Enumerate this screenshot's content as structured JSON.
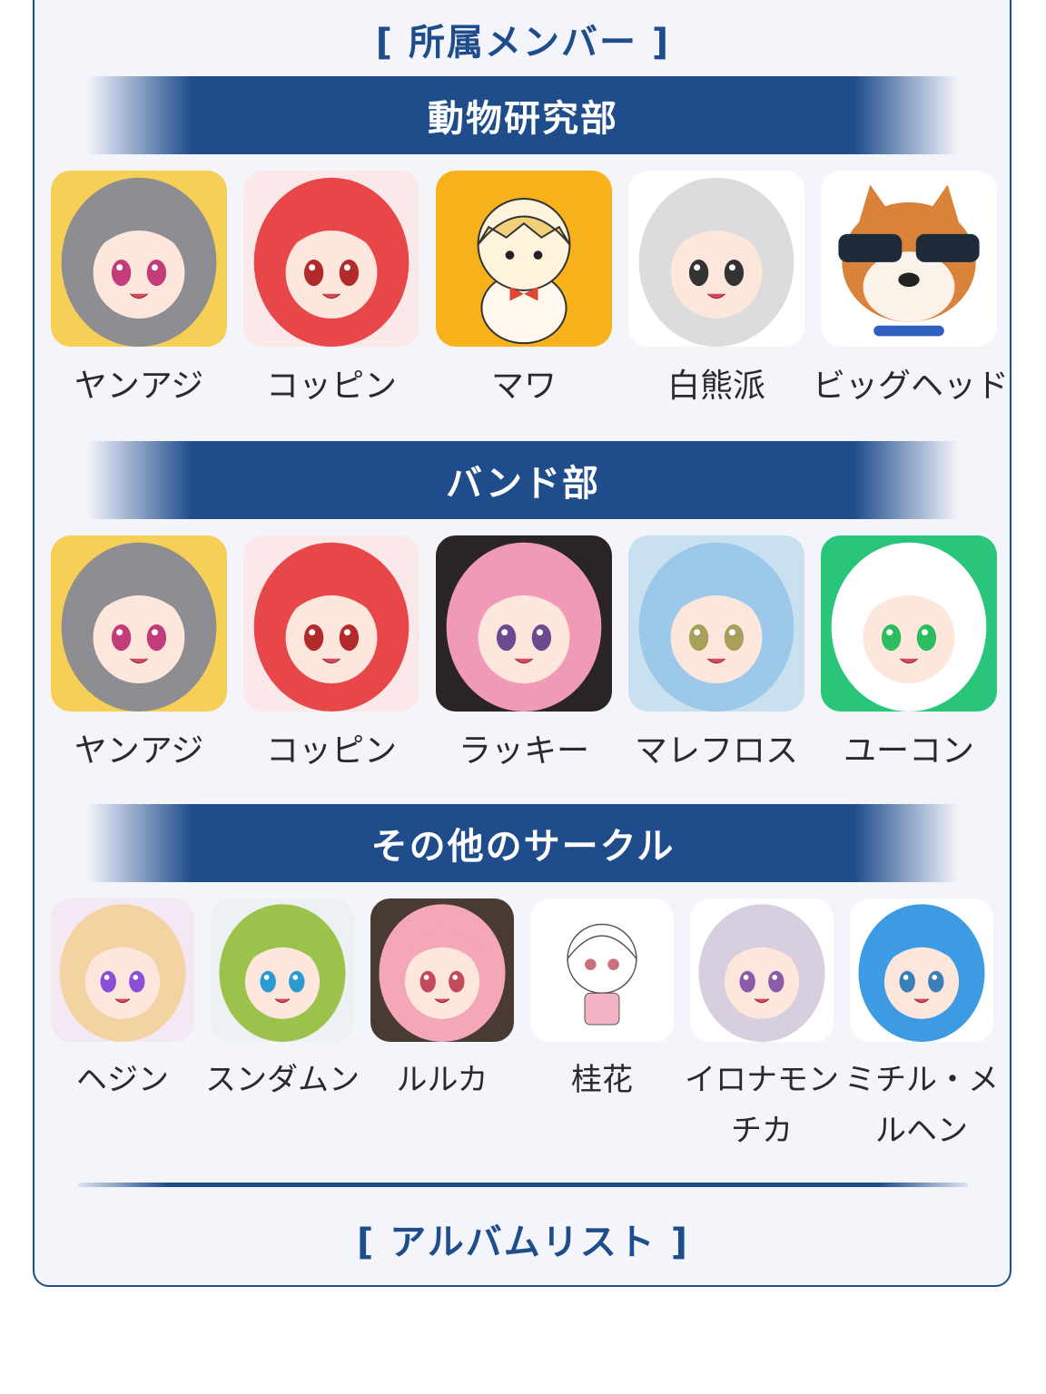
{
  "members_heading": "[ 所属メンバー ]",
  "album_heading": "[ アルバムリスト ]",
  "sections": [
    {
      "title": "動物研究部",
      "members": [
        {
          "name": "ヤンアジ",
          "avatar": "gray-hair-girl-icon",
          "bg": "#f6cf56"
        },
        {
          "name": "コッピン",
          "avatar": "red-hair-girl-icon",
          "bg": "#fbe9ea"
        },
        {
          "name": "マワ",
          "avatar": "blonde-hamster-girl-icon",
          "bg": "#f7b21b"
        },
        {
          "name": "白熊派",
          "avatar": "white-hair-bear-girl-icon",
          "bg": "#ffffff"
        },
        {
          "name": "ビッグヘッド",
          "avatar": "shiba-dog-icon",
          "bg": "#ffffff"
        }
      ]
    },
    {
      "title": "バンド部",
      "members": [
        {
          "name": "ヤンアジ",
          "avatar": "gray-hair-girl-icon",
          "bg": "#f6cf56"
        },
        {
          "name": "コッピン",
          "avatar": "red-hair-girl-icon",
          "bg": "#fbe9ea"
        },
        {
          "name": "ラッキー",
          "avatar": "pink-hair-girl-icon",
          "bg": "#2b2424"
        },
        {
          "name": "マレフロス",
          "avatar": "blue-hair-girl-icon",
          "bg": "#c9e0ee"
        },
        {
          "name": "ユーコン",
          "avatar": "white-cat-girl-icon",
          "bg": "#28c57a"
        }
      ]
    },
    {
      "title": "その他のサークル",
      "members": [
        {
          "name": "ヘジン",
          "avatar": "blonde-purple-eye-girl-icon",
          "bg": "#f3e8f4"
        },
        {
          "name": "スンダムン",
          "avatar": "green-hair-boy-icon",
          "bg": "#eef1f4"
        },
        {
          "name": "ルルカ",
          "avatar": "pink-long-hair-girl-icon",
          "bg": "#4a3a34"
        },
        {
          "name": "桂花",
          "avatar": "sketch-chibi-girl-icon",
          "bg": "#ffffff"
        },
        {
          "name": "イロナモンチカ",
          "avatar": "silver-hair-bat-girl-icon",
          "bg": "#ffffff"
        },
        {
          "name": "ミチル・メルヘン",
          "avatar": "blue-hair-princess-icon",
          "bg": "#ffffff"
        }
      ]
    }
  ]
}
